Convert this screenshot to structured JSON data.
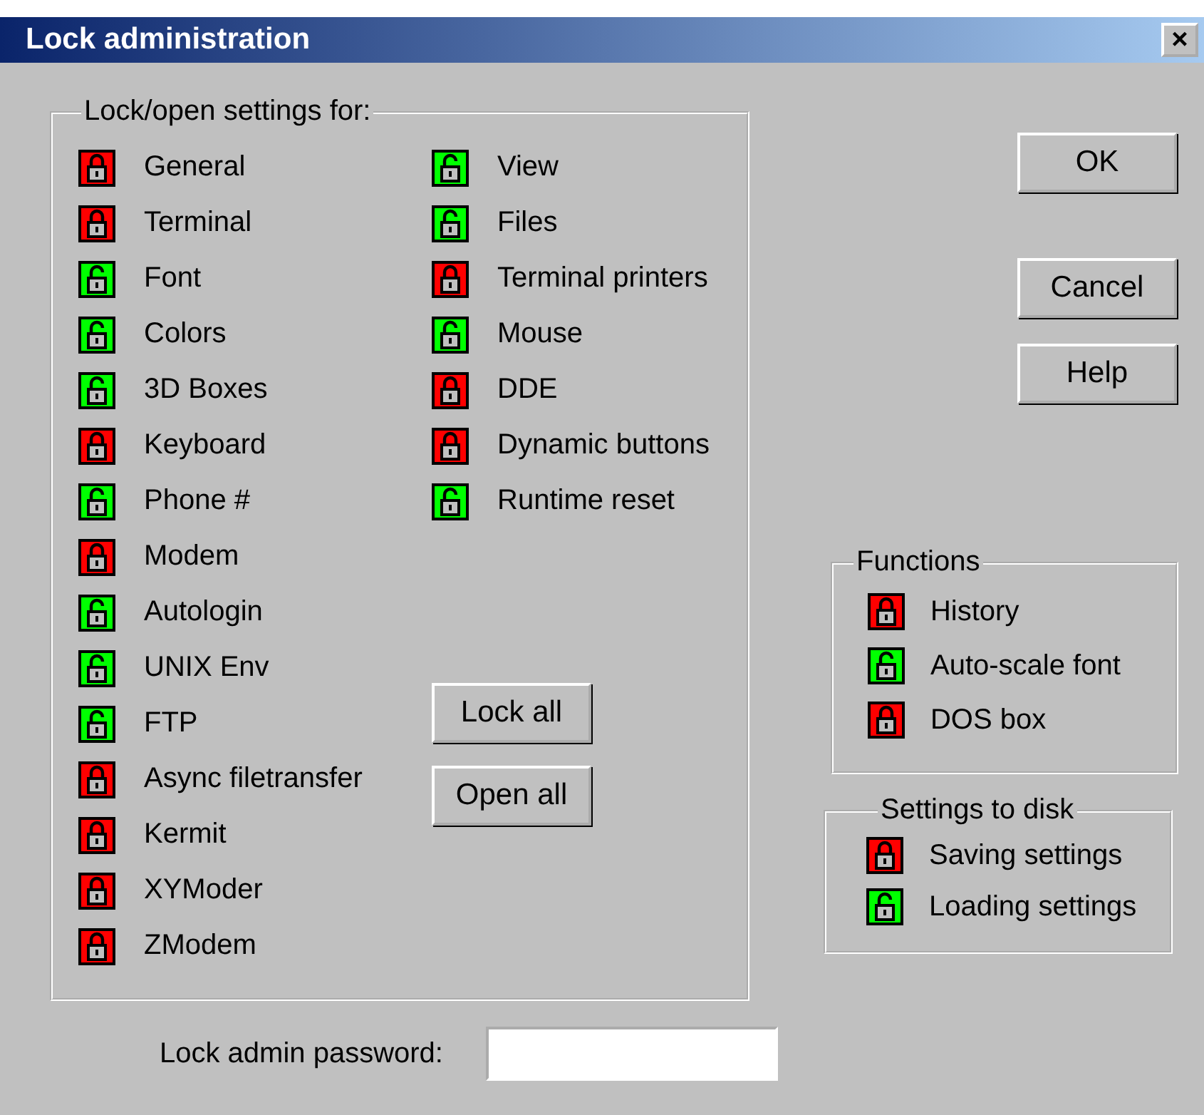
{
  "window": {
    "title": "Lock administration",
    "close": "×"
  },
  "settings_group": {
    "title": "Lock/open settings for:",
    "column_1": [
      {
        "label": "General",
        "locked": true
      },
      {
        "label": "Terminal",
        "locked": true
      },
      {
        "label": "Font",
        "locked": false
      },
      {
        "label": "Colors",
        "locked": false
      },
      {
        "label": "3D Boxes",
        "locked": false
      },
      {
        "label": "Keyboard",
        "locked": true
      },
      {
        "label": "Phone #",
        "locked": false
      },
      {
        "label": "Modem",
        "locked": true
      },
      {
        "label": "Autologin",
        "locked": false
      },
      {
        "label": "UNIX Env",
        "locked": false
      },
      {
        "label": "FTP",
        "locked": false
      },
      {
        "label": "Async filetransfer",
        "locked": true
      },
      {
        "label": "Kermit",
        "locked": true
      },
      {
        "label": "XYModer",
        "locked": true
      },
      {
        "label": "ZModem",
        "locked": true
      }
    ],
    "column_2": [
      {
        "label": "View",
        "locked": false
      },
      {
        "label": "Files",
        "locked": false
      },
      {
        "label": "Terminal printers",
        "locked": true
      },
      {
        "label": "Mouse",
        "locked": false
      },
      {
        "label": "DDE",
        "locked": true
      },
      {
        "label": "Dynamic buttons",
        "locked": true
      },
      {
        "label": "Runtime reset",
        "locked": false
      }
    ],
    "buttons": [
      "Lock all",
      "Open all"
    ]
  },
  "buttons": [
    "OK",
    "Cancel",
    "Help"
  ],
  "functions_group": {
    "title": "Functions",
    "items": [
      {
        "label": "History",
        "locked": true
      },
      {
        "label": "Auto-scale font",
        "locked": false
      },
      {
        "label": "DOS box",
        "locked": true
      }
    ]
  },
  "disk_group": {
    "title": "Settings to disk",
    "items": [
      {
        "label": "Saving settings",
        "locked": true
      },
      {
        "label": "Loading settings",
        "locked": false
      }
    ]
  },
  "password": {
    "label": "Lock admin password:"
  }
}
